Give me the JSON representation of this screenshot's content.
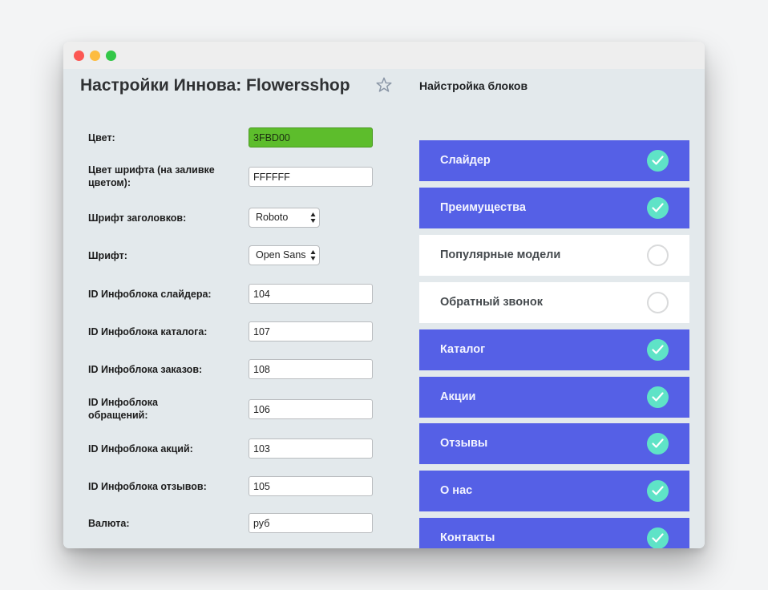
{
  "page_title": "Настройки Иннова: Flowersshop",
  "blocks_section_title": "Найстройка блоков",
  "form": [
    {
      "label": "Цвет:",
      "value": "3FBD00",
      "kind": "color",
      "name": "color"
    },
    {
      "label": "Цвет шрифта (на заливке цветом):",
      "value": "FFFFFF",
      "kind": "text",
      "name": "font-color"
    },
    {
      "label": "Шрифт заголовков:",
      "value": "Roboto",
      "kind": "select",
      "name": "heading-font"
    },
    {
      "label": "Шрифт:",
      "value": "Open Sans",
      "kind": "select",
      "name": "font"
    },
    {
      "label": "ID Инфоблока слайдера:",
      "value": "104",
      "kind": "text",
      "name": "slider-iblock-id"
    },
    {
      "label": "ID Инфоблока каталога:",
      "value": "107",
      "kind": "text",
      "name": "catalog-iblock-id"
    },
    {
      "label": "ID Инфоблока заказов:",
      "value": "108",
      "kind": "text",
      "name": "orders-iblock-id"
    },
    {
      "label": "ID Инфоблока обращений:",
      "value": "106",
      "kind": "text",
      "name": "requests-iblock-id"
    },
    {
      "label": "ID Инфоблока акций:",
      "value": "103",
      "kind": "text",
      "name": "promos-iblock-id"
    },
    {
      "label": "ID Инфоблока отзывов:",
      "value": "105",
      "kind": "text",
      "name": "reviews-iblock-id"
    },
    {
      "label": "Валюта:",
      "value": "руб",
      "kind": "text",
      "name": "currency"
    }
  ],
  "blocks": [
    {
      "label": "Слайдер",
      "enabled": true
    },
    {
      "label": "Преимущества",
      "enabled": true
    },
    {
      "label": "Популярные модели",
      "enabled": false
    },
    {
      "label": "Обратный звонок",
      "enabled": false
    },
    {
      "label": "Каталог",
      "enabled": true
    },
    {
      "label": "Акции",
      "enabled": true
    },
    {
      "label": "Отзывы",
      "enabled": true
    },
    {
      "label": "О нас",
      "enabled": true
    },
    {
      "label": "Контакты",
      "enabled": true
    }
  ],
  "icons": {
    "favorite": "star-icon",
    "enabled": "checkmark-icon",
    "disabled": "empty-circle-icon",
    "select": "select-arrows-icon"
  },
  "colors": {
    "accent": "#5560e6",
    "check": "#5fe3c7",
    "color_swatch": "#5dbd2c"
  }
}
